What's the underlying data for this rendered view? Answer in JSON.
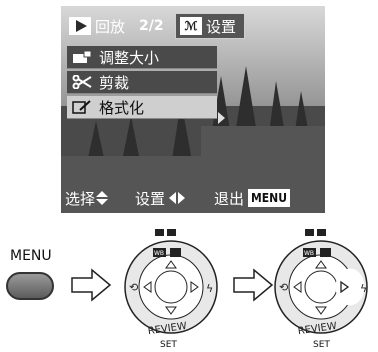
{
  "screen": {
    "tabs": {
      "play_label": "回放",
      "page_indicator": "2/2",
      "setup_icon_text": "ℳ",
      "setup_label": "设置"
    },
    "menu_items": [
      {
        "label": "调整大小",
        "icon": "resize-icon",
        "selected": false
      },
      {
        "label": "剪裁",
        "icon": "scissors-icon",
        "selected": false
      },
      {
        "label": "格式化",
        "icon": "format-icon",
        "selected": true
      }
    ],
    "bottom": {
      "select_label": "选择",
      "set_label": "设置",
      "exit_label": "退出",
      "menu_badge": "MENU"
    }
  },
  "controls": {
    "menu_button_label": "MENU",
    "dial_review_label": "REVIEW",
    "dial_set_label": "SET",
    "dial_wb_label": "WB"
  },
  "colors": {
    "screen_bg": "#3a3a3a",
    "menu_item_bg": "#4a4a4a",
    "menu_selected_bg": "#cfcfcf"
  }
}
